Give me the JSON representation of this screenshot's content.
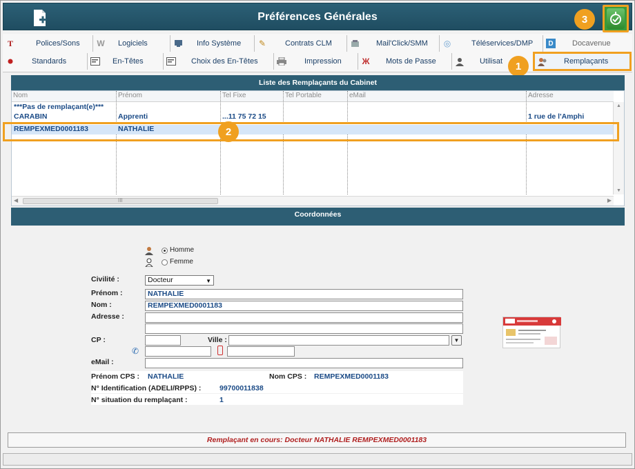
{
  "window": {
    "title": "Préférences Générales"
  },
  "tabs_row1": [
    {
      "label": "Polices/Sons",
      "icon": "font-icon"
    },
    {
      "label": "Logiciels",
      "icon": "software-icon"
    },
    {
      "label": "Info Système",
      "icon": "system-icon"
    },
    {
      "label": "Contrats CLM",
      "icon": "pencil-icon"
    },
    {
      "label": "Mail'Click/SMM",
      "icon": "mail-icon"
    },
    {
      "label": "Téléservices/DMP",
      "icon": "teleservice-icon"
    },
    {
      "label": "Docavenue",
      "icon": "docavenue-icon"
    }
  ],
  "tabs_row2": [
    {
      "label": "Standards",
      "icon": "red-dot-icon"
    },
    {
      "label": "En-Têtes",
      "icon": "header-icon"
    },
    {
      "label": "Choix des En-Têtes",
      "icon": "header-choice-icon"
    },
    {
      "label": "Impression",
      "icon": "printer-icon"
    },
    {
      "label": "Mots de Passe",
      "icon": "password-icon"
    },
    {
      "label": "Utilisat",
      "icon": "user-icon"
    },
    {
      "label": "Remplaçants",
      "icon": "replacement-icon"
    }
  ],
  "badges": {
    "one": "1",
    "two": "2",
    "three": "3"
  },
  "list": {
    "title": "Liste des Remplaçants du Cabinet",
    "columns": [
      "Nom",
      "Prénom",
      "Tel Fixe",
      "Tel Portable",
      "eMail",
      "Adresse"
    ],
    "rows": [
      {
        "nom": "***Pas de remplaçant(e)***",
        "prenom": "",
        "tel_fixe": "",
        "tel_portable": "",
        "email": "",
        "adresse": ""
      },
      {
        "nom": "CARABIN",
        "prenom": "Apprenti",
        "tel_fixe": "...11 75 72 15",
        "tel_portable": "",
        "email": "",
        "adresse": "1 rue de l'Amphi"
      },
      {
        "nom": "REMPEXMED0001183",
        "prenom": "NATHALIE",
        "tel_fixe": "",
        "tel_portable": "",
        "email": "",
        "adresse": ""
      }
    ],
    "hscroll_label": "III"
  },
  "coordonnees": {
    "title": "Coordonnées",
    "gender": {
      "homme": "Homme",
      "femme": "Femme",
      "selected": "Homme"
    },
    "civilite_label": "Civilité :",
    "civilite_value": "Docteur",
    "prenom_label": "Prénom :",
    "prenom_value": "NATHALIE",
    "nom_label": "Nom :",
    "nom_value": "REMPEXMED0001183",
    "adresse_label": "Adresse :",
    "adresse_line1": "",
    "adresse_line2": "",
    "cp_label": "CP :",
    "cp_value": "",
    "ville_label": "Ville :",
    "ville_value": "",
    "phone_fixe": "",
    "phone_portable": "",
    "email_label": "eMail :",
    "email_value": "",
    "prenom_cps_label": "Prénom CPS :",
    "prenom_cps_value": "NATHALIE",
    "nom_cps_label": "Nom CPS :",
    "nom_cps_value": "REMPEXMED0001183",
    "adeli_label": "N° Identification (ADELI/RPPS) :",
    "adeli_value": "99700011838",
    "situation_label": "N° situation du remplaçant :",
    "situation_value": "1"
  },
  "status": {
    "text": "Remplaçant en cours: Docteur NATHALIE REMPEXMED0001183"
  },
  "colors": {
    "header_bg": "#2d5e74",
    "highlight": "#f0a020",
    "value_text": "#1a4a86",
    "status_text": "#b02020"
  }
}
